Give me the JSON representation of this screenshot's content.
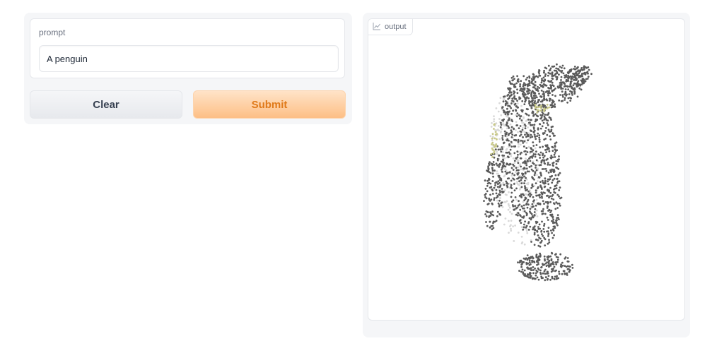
{
  "prompt": {
    "label": "prompt",
    "value": "A penguin"
  },
  "buttons": {
    "clear_label": "Clear",
    "submit_label": "Submit"
  },
  "output": {
    "label": "output",
    "icon": "chart-icon",
    "subject": "penguin point cloud"
  },
  "colors": {
    "accent": "#e07a1a",
    "submit_bg": "#fdbf85",
    "points_dark": "#5a5a5a",
    "points_light": "#d9d9d9",
    "points_yellow": "#c9c98a"
  }
}
